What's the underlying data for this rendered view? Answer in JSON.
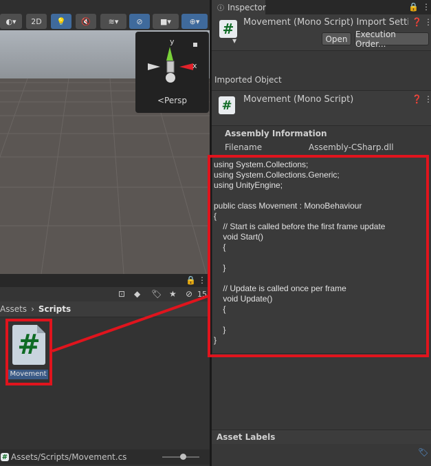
{
  "scene": {
    "toolbar": {
      "mode_2d": "2D"
    },
    "gizmo": {
      "y_axis": "y",
      "x_axis": "x",
      "projection": "Persp"
    }
  },
  "project": {
    "breadcrumb": {
      "root": "Assets",
      "separator": "›",
      "current": "Scripts"
    },
    "hidden_count": "15",
    "asset": {
      "name": "Movement",
      "icon": "#"
    },
    "status_path": "Assets/Scripts/Movement.cs"
  },
  "inspector": {
    "tab_label": "Inspector",
    "header_title": "Movement (Mono Script) Import Settir",
    "open_button": "Open",
    "execution_order_button": "Execution Order...",
    "imported_object_label": "Imported Object",
    "imported_title": "Movement (Mono Script)",
    "assembly_heading": "Assembly Information",
    "filename_label": "Filename",
    "filename_value": "Assembly-CSharp.dll",
    "code": "using System.Collections;\nusing System.Collections.Generic;\nusing UnityEngine;\n\npublic class Movement : MonoBehaviour\n{\n    // Start is called before the first frame update\n    void Start()\n    {\n\n    }\n\n    // Update is called once per frame\n    void Update()\n    {\n\n    }\n}",
    "asset_labels_heading": "Asset Labels"
  },
  "colors": {
    "highlight_red": "#e0141d",
    "hash_green": "#0e6b24",
    "toolbar_active": "#3f6a9c"
  }
}
